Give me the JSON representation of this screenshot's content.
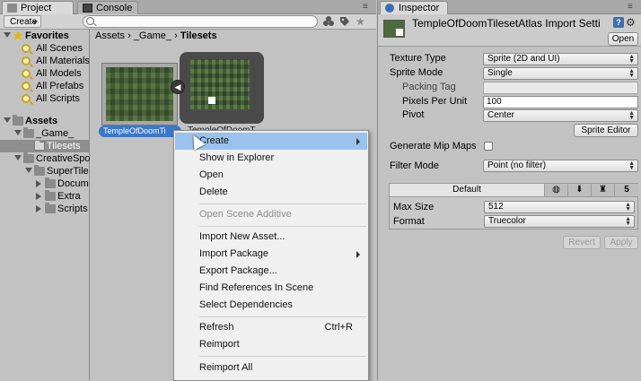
{
  "project": {
    "tabs": [
      {
        "label": "Project"
      },
      {
        "label": "Console"
      }
    ],
    "create_label": "Create",
    "search_placeholder": "",
    "favorites": {
      "header": "Favorites",
      "items": [
        "All Scenes",
        "All Materials",
        "All Models",
        "All Prefabs",
        "All Scripts"
      ]
    },
    "assets": {
      "header": "Assets",
      "game": "_Game_",
      "tilesets": "Tilesets",
      "creative": "CreativeSpo",
      "supertile": "SuperTile",
      "docum": "Docum",
      "extra": "Extra",
      "scripts": "Scripts"
    },
    "breadcrumb": {
      "p1": "Assets",
      "sep1": "›",
      "p2": "_Game_",
      "sep2": "›",
      "p3": "Tilesets"
    },
    "asset1_label": "TempleOfDoomTi",
    "asset2_label": "TempleOfDoomT"
  },
  "context_menu": {
    "items": [
      {
        "label": "Create",
        "submenu": true
      },
      {
        "label": "Show in Explorer"
      },
      {
        "label": "Open"
      },
      {
        "label": "Delete"
      },
      {
        "label": "Open Scene Additive"
      },
      {
        "label": "Import New Asset..."
      },
      {
        "label": "Import Package",
        "submenu": true
      },
      {
        "label": "Export Package..."
      },
      {
        "label": "Find References In Scene"
      },
      {
        "label": "Select Dependencies"
      },
      {
        "label": "Refresh",
        "shortcut": "Ctrl+R"
      },
      {
        "label": "Reimport"
      },
      {
        "label": "Reimport All"
      }
    ]
  },
  "inspector": {
    "tab_label": "Inspector",
    "title": "TempleOfDoomTilesetAtlas Import Setti",
    "open_label": "Open",
    "texture_type": {
      "label": "Texture Type",
      "value": "Sprite (2D and UI)"
    },
    "sprite_mode": {
      "label": "Sprite Mode",
      "value": "Single"
    },
    "packing_tag": {
      "label": "Packing Tag",
      "value": ""
    },
    "pixels_per_unit": {
      "label": "Pixels Per Unit",
      "value": "100"
    },
    "pivot": {
      "label": "Pivot",
      "value": "Center"
    },
    "sprite_editor_label": "Sprite Editor",
    "generate_mip_maps": {
      "label": "Generate Mip Maps",
      "checked": false
    },
    "filter_mode": {
      "label": "Filter Mode",
      "value": "Point (no filter)"
    },
    "platform_default": "Default",
    "max_size": {
      "label": "Max Size",
      "value": "512"
    },
    "format": {
      "label": "Format",
      "value": "Truecolor"
    },
    "revert_label": "Revert",
    "apply_label": "Apply"
  },
  "colors": {
    "panel_bg": "#c2c2c2",
    "selection_blue": "#3a78c9",
    "menu_highlight": "#9ac2ec"
  }
}
